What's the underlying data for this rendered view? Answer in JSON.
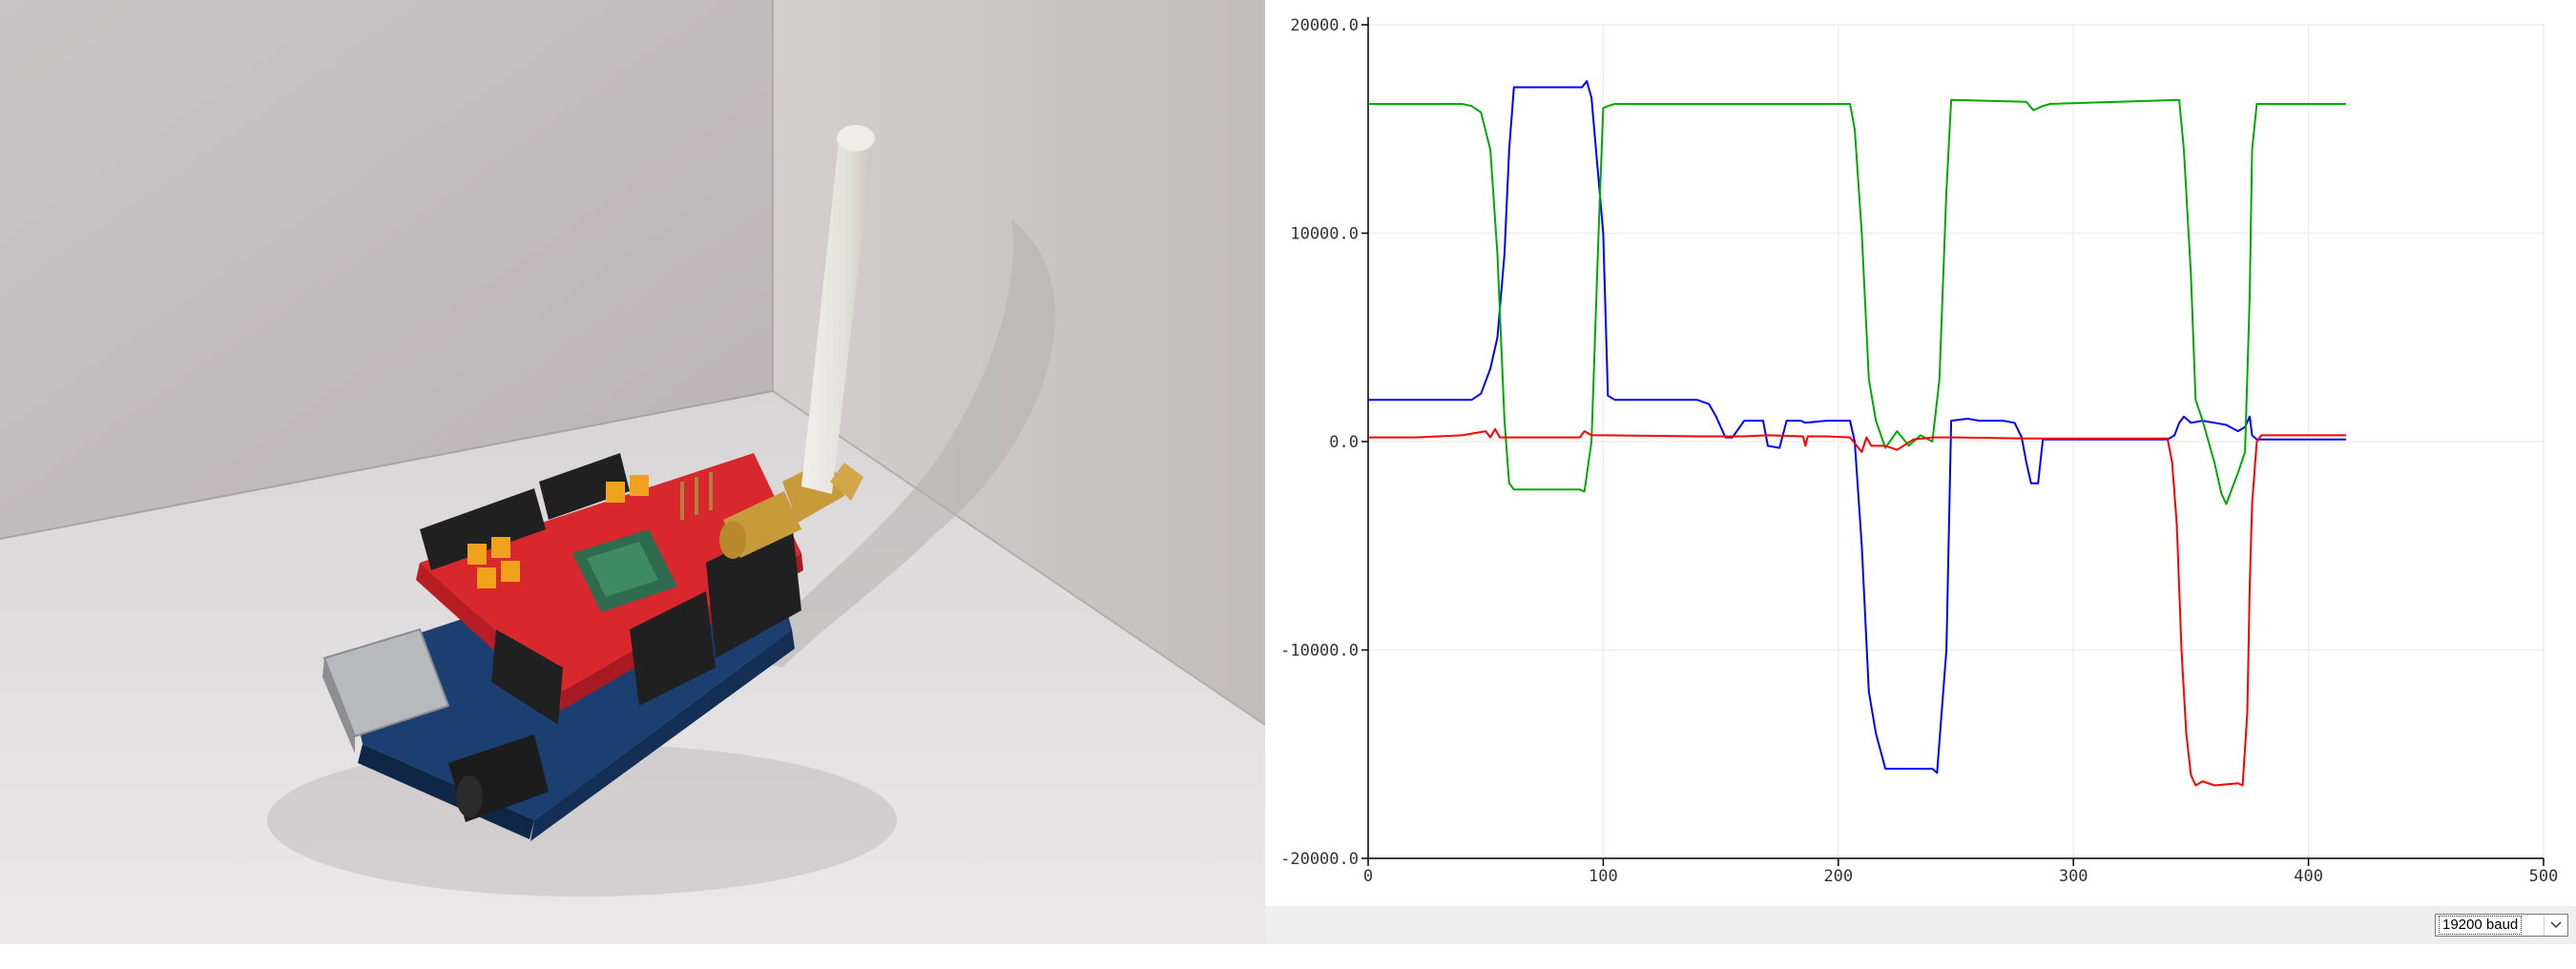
{
  "photo": {
    "description_icon": "arduino-lora-shield-photo"
  },
  "plotter": {
    "baud_selector": {
      "value": "19200 baud",
      "icon": "chevron-down-icon"
    }
  },
  "chart_data": {
    "type": "line",
    "title": "",
    "xlabel": "",
    "ylabel": "",
    "xlim": [
      0,
      500
    ],
    "ylim": [
      -20000,
      20000
    ],
    "x_ticks": [
      0,
      100,
      200,
      300,
      400,
      500
    ],
    "x_tick_labels": [
      "0",
      "100",
      "200",
      "300",
      "400",
      "500"
    ],
    "y_ticks": [
      -20000,
      -10000,
      0,
      10000,
      20000
    ],
    "y_tick_labels": [
      "-20000.0",
      "-10000.0",
      "0.0",
      "10000.0",
      "20000.0"
    ],
    "grid": true,
    "series": [
      {
        "color": "#0000ff",
        "x": [
          0,
          44,
          48,
          52,
          55,
          58,
          60,
          62,
          91,
          93,
          95,
          100,
          102,
          105,
          140,
          145,
          148,
          152,
          155,
          160,
          162,
          168,
          170,
          175,
          178,
          184,
          186,
          195,
          205,
          207,
          210,
          213,
          216,
          220,
          225,
          240,
          242,
          246,
          248,
          255,
          260,
          270,
          275,
          278,
          280,
          282,
          285,
          287,
          290,
          300,
          340,
          343,
          345,
          347,
          350,
          355,
          360,
          365,
          370,
          373,
          375,
          376,
          378,
          380,
          385,
          400,
          416
        ],
        "y": [
          2000,
          2000,
          2300,
          3500,
          5000,
          9000,
          14000,
          17000,
          17000,
          17300,
          16500,
          10000,
          2200,
          2000,
          2000,
          1800,
          1200,
          200,
          200,
          1000,
          1000,
          1000,
          -200,
          -300,
          1000,
          1000,
          900,
          1000,
          1000,
          0,
          -5000,
          -12000,
          -14000,
          -15700,
          -15700,
          -15700,
          -15900,
          -10000,
          1000,
          1100,
          1000,
          1000,
          900,
          200,
          -1000,
          -2000,
          -2000,
          100,
          100,
          100,
          100,
          300,
          900,
          1200,
          900,
          1000,
          900,
          800,
          500,
          700,
          1200,
          300,
          100,
          100,
          100,
          100,
          100
        ]
      },
      {
        "color": "#00aa00",
        "x": [
          0,
          40,
          44,
          48,
          52,
          55,
          58,
          60,
          62,
          90,
          92,
          95,
          98,
          100,
          102,
          105,
          150,
          180,
          205,
          207,
          210,
          213,
          216,
          220,
          225,
          230,
          235,
          240,
          243,
          246,
          248,
          280,
          283,
          287,
          290,
          345,
          347,
          350,
          352,
          355,
          360,
          363,
          365,
          370,
          373,
          375,
          376,
          378,
          380,
          416
        ],
        "y": [
          16200,
          16200,
          16100,
          15800,
          14000,
          9000,
          1000,
          -2000,
          -2300,
          -2300,
          -2400,
          0,
          10000,
          16000,
          16100,
          16200,
          16200,
          16200,
          16200,
          15000,
          10000,
          3000,
          1000,
          -300,
          500,
          -200,
          300,
          0,
          3000,
          12000,
          16400,
          16300,
          15900,
          16100,
          16200,
          16400,
          14000,
          8000,
          2000,
          1000,
          -1000,
          -2500,
          -3000,
          -1500,
          -500,
          7000,
          14000,
          16200,
          16200,
          16200
        ]
      },
      {
        "color": "#ff0000",
        "x": [
          0,
          20,
          40,
          50,
          52,
          54,
          56,
          60,
          80,
          90,
          92,
          95,
          100,
          140,
          160,
          170,
          185,
          186,
          187,
          195,
          205,
          210,
          212,
          214,
          220,
          225,
          232,
          240,
          250,
          280,
          340,
          342,
          344,
          346,
          348,
          350,
          352,
          355,
          360,
          370,
          372,
          374,
          375,
          376,
          378,
          380,
          416
        ],
        "y": [
          200,
          200,
          300,
          500,
          200,
          600,
          200,
          200,
          200,
          200,
          500,
          300,
          300,
          250,
          250,
          300,
          250,
          -200,
          250,
          250,
          200,
          -500,
          200,
          -200,
          -200,
          -400,
          100,
          200,
          200,
          150,
          150,
          -1000,
          -4000,
          -10000,
          -14000,
          -16000,
          -16500,
          -16300,
          -16500,
          -16400,
          -16500,
          -13000,
          -7000,
          -3000,
          0,
          300,
          300
        ]
      }
    ]
  }
}
